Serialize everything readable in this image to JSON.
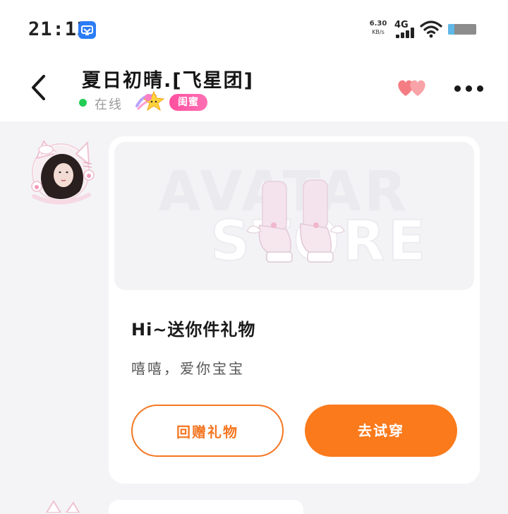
{
  "status_bar": {
    "time": "21:12",
    "net_speed_value": "6.30",
    "net_speed_unit": "KB/s",
    "network_type": "4G",
    "battery_level": 0.22
  },
  "header": {
    "title": "夏日初晴.[飞星团]",
    "status": "在线",
    "tag": "闺蜜"
  },
  "message": {
    "gift_title": "Hi~送你件礼物",
    "gift_message": "嘻嘻，爱你宝宝",
    "watermark_line1": "AVATAR",
    "watermark_line2": "STORE",
    "return_gift_label": "回赠礼物",
    "try_on_label": "去试穿"
  },
  "colors": {
    "accent_orange": "#fa7a1c",
    "online_green": "#22cc55",
    "tag_pink": "#ff4f9e",
    "heart_pink": "#f47c83"
  },
  "icons": {
    "back": "chevron-left-icon",
    "hearts": "hearts-icon",
    "more": "more-icon",
    "wifi": "wifi-icon",
    "signal": "signal-icon",
    "battery": "battery-icon"
  }
}
